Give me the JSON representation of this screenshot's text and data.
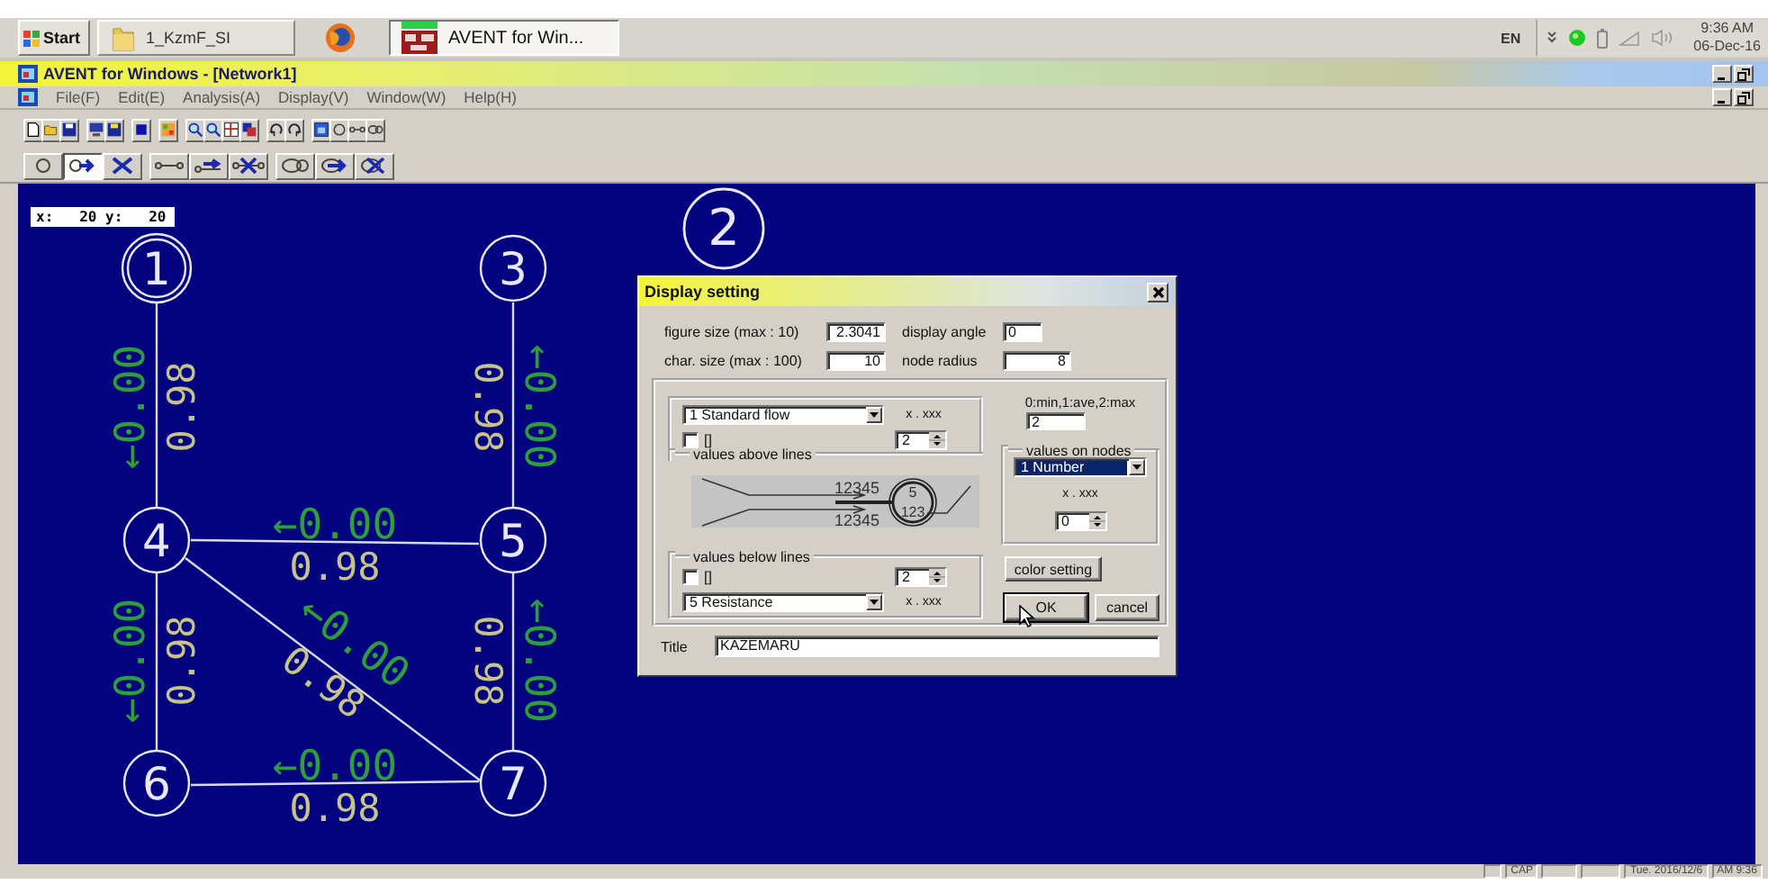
{
  "taskbar": {
    "start_button": "Start",
    "tasks": [
      {
        "label": "1_KzmF_SI",
        "kind": "folder",
        "selected": false
      },
      {
        "kind": "browser",
        "selected": false
      },
      {
        "label": "AVENT for Win...",
        "kind": "app",
        "selected": true
      }
    ],
    "tray": {
      "language": "EN",
      "time": "9:36 AM",
      "date": "06-Dec-16"
    }
  },
  "window": {
    "title": "AVENT for Windows - [Network1]",
    "menu": [
      "File(F)",
      "Edit(E)",
      "Analysis(A)",
      "Display(V)",
      "Window(W)",
      "Help(H)"
    ]
  },
  "mode_tools": [
    {
      "kind": "node",
      "selected": false
    },
    {
      "kind": "move",
      "selected": true
    },
    {
      "kind": "delete",
      "selected": false
    },
    {
      "kind": "link",
      "selected": false
    },
    {
      "kind": "link-move",
      "selected": false
    },
    {
      "kind": "link-delete",
      "selected": false
    },
    {
      "kind": "pipe",
      "selected": false
    },
    {
      "kind": "pipe-move",
      "selected": false
    },
    {
      "kind": "pipe-delete",
      "selected": false
    }
  ],
  "canvas": {
    "coordinates": "x:   20 y:   20",
    "nodes": [
      {
        "label": "1",
        "kind": "double"
      },
      {
        "label": "2",
        "kind": "large"
      },
      {
        "label": "3",
        "kind": "plain"
      },
      {
        "label": "4",
        "kind": "plain"
      },
      {
        "label": "5",
        "kind": "plain"
      },
      {
        "label": "6",
        "kind": "plain"
      },
      {
        "label": "7",
        "kind": "plain"
      }
    ],
    "edges": [
      {
        "flow": "←0.00",
        "resistance": "0.98"
      },
      {
        "flow": "←0.00",
        "resistance": "0.98"
      },
      {
        "flow": "←0.00",
        "resistance": "0.98"
      },
      {
        "flow": "←0.00",
        "resistance": "0.98"
      },
      {
        "flow": "←0.00",
        "resistance": "0.98"
      },
      {
        "flow": "←0.00",
        "resistance": "0.98"
      },
      {
        "flow": "←0.00",
        "resistance": "0.98"
      }
    ]
  },
  "dialog": {
    "title": "Display setting",
    "fields": [
      {
        "label": "figure size (max : 10)",
        "value": "2.3041"
      },
      {
        "label": "display angle",
        "value": "0"
      },
      {
        "label": "char. size (max : 100)",
        "value": "10"
      },
      {
        "label": "node radius",
        "value": "8"
      }
    ],
    "above_lines": {
      "group": "values above lines",
      "dropdown": "1 Standard flow",
      "format": "x . xxx",
      "checkbox": {
        "label": "[]",
        "checked": false
      },
      "digits": "2"
    },
    "preview": {
      "above": "12345",
      "below": "12345",
      "node": "5",
      "node_value": "123"
    },
    "below_lines": {
      "group": "values below lines",
      "checkbox": {
        "label": "[]",
        "checked": false
      },
      "digits": "2",
      "dropdown": "5 Resistance",
      "format": "x . xxx"
    },
    "node_mode": {
      "label": "0:min,1:ave,2:max",
      "value": "2"
    },
    "on_nodes": {
      "group": "values on nodes",
      "dropdown": "1 Number",
      "focused": true,
      "format": "x . xxx",
      "digits": "0"
    },
    "buttons": [
      {
        "label": "color setting",
        "default": false
      },
      {
        "label": "OK",
        "default": true
      },
      {
        "label": "cancel",
        "default": false
      }
    ],
    "title_field": {
      "label": "Title",
      "value": "KAZEMARU"
    }
  },
  "status_bar": {
    "panels": [
      "CAP",
      "Tue. 2016/12/6",
      "AM 9:36"
    ]
  }
}
